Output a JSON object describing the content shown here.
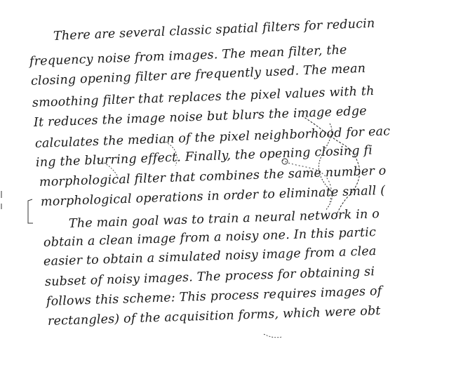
{
  "document": {
    "lines": [
      "There are several classic spatial filters for reducin",
      "frequency noise from images.  The mean filter, the",
      "closing opening filter are frequently used.  The mean",
      "smoothing filter that replaces the pixel values with th",
      "It reduces the image noise but blurs the image edge",
      "calculates the median of the pixel neighborhood for eac",
      "ing the blurring effect.  Finally, the opening closing fi",
      "morphological filter that combines the same number o",
      "morphological operations in order to eliminate small (",
      "The main goal was to train a neural network in o",
      "obtain a clean image from a noisy one.  In this partic",
      "easier to obtain a simulated noisy image from a clea",
      "subset of noisy images.  The process for obtaining si",
      "follows this scheme: This process requires images of",
      "rectangles) of the acquisition forms, which were obt"
    ],
    "ink_color": "#1a1a1a"
  }
}
